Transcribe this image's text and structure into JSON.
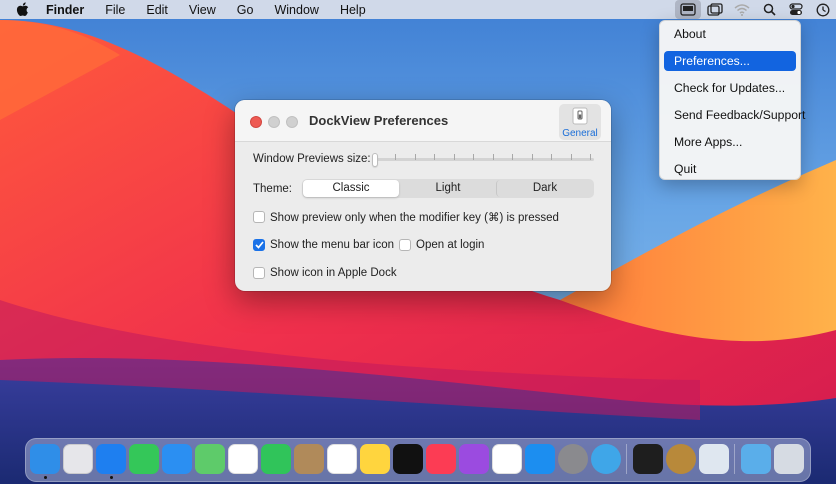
{
  "menubar": {
    "app_name": "Finder",
    "items": [
      "File",
      "Edit",
      "View",
      "Go",
      "Window",
      "Help"
    ],
    "status_icons": [
      "dockview-icon",
      "window-switch-icon",
      "wifi-icon",
      "search-icon",
      "control-center-icon",
      "clock-icon"
    ]
  },
  "dropdown": {
    "items": [
      "About",
      "Preferences...",
      "Check for Updates...",
      "Send Feedback/Support",
      "More Apps...",
      "Quit"
    ],
    "selected": "Preferences..."
  },
  "prefs": {
    "title": "DockView Preferences",
    "tab_label": "General",
    "previews_size_label": "Window Previews size:",
    "previews_size_value": 0,
    "theme_label": "Theme:",
    "theme_options": [
      "Classic",
      "Light",
      "Dark"
    ],
    "theme_selected": "Classic",
    "modifier_label": "Show preview only when the modifier key (⌘) is pressed",
    "modifier_checked": false,
    "menubar_icon_label": "Show the menu bar icon",
    "menubar_icon_checked": true,
    "login_label": "Open at login",
    "login_checked": false,
    "dock_icon_label": "Show icon in Apple Dock",
    "dock_icon_checked": false
  },
  "dock": {
    "apps": [
      "finder",
      "launchpad",
      "safari",
      "messages",
      "mail",
      "maps",
      "photos",
      "facetime",
      "contacts",
      "reminders",
      "notes",
      "tv",
      "music",
      "podcasts",
      "news",
      "app-store",
      "system-preferences",
      "mountain-app",
      "terminal",
      "audio-app",
      "preview",
      "downloads-folder",
      "trash"
    ],
    "colors": {
      "finder": "#2f8ee8",
      "launchpad": "#e6e6ea",
      "safari": "#1e7ff0",
      "messages": "#34c759",
      "mail": "#2b8ff2",
      "maps": "#5ecb6a",
      "photos": "#ffffff",
      "facetime": "#30c45a",
      "contacts": "#b08a5a",
      "reminders": "#ffffff",
      "notes": "#ffd53e",
      "tv": "#111111",
      "music": "#fc3c54",
      "podcasts": "#9b4be0",
      "news": "#ffffff",
      "app-store": "#1c8ef0",
      "system-preferences": "#8a8a8e",
      "mountain-app": "#3fa6e8",
      "terminal": "#1e1e1e",
      "audio-app": "#b8893a",
      "preview": "#dfe7f0",
      "downloads-folder": "#5aaeea",
      "trash": "#d6dbe3"
    }
  }
}
